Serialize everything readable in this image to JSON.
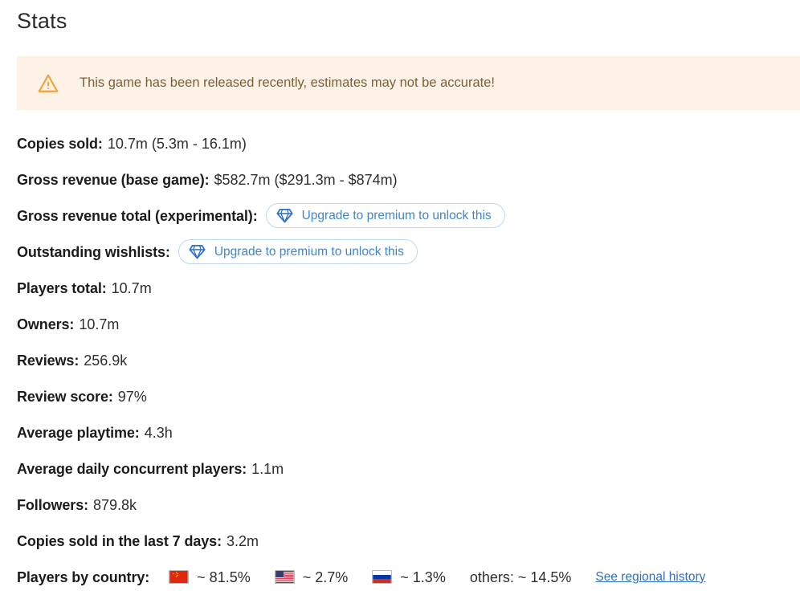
{
  "page_title": "Stats",
  "warning": {
    "icon": "warning-triangle-icon",
    "message": "This game has been released recently, estimates may not be accurate!",
    "background_color": "#fdf2e5",
    "text_color": "#7a6036",
    "icon_color": "#f0a33c"
  },
  "premium": {
    "icon": "gem-icon",
    "label": "Upgrade to premium to unlock this",
    "text_color": "#4285c9",
    "border_color": "#bcd7ef"
  },
  "stats": [
    {
      "label": "Copies sold:",
      "value": "10.7m (5.3m - 16.1m)",
      "locked": false
    },
    {
      "label": "Gross revenue (base game):",
      "value": "$582.7m ($291.3m - $874m)",
      "locked": false
    },
    {
      "label": "Gross revenue total (experimental):",
      "value": "",
      "locked": true
    },
    {
      "label": "Outstanding wishlists:",
      "value": "",
      "locked": true
    },
    {
      "label": "Players total:",
      "value": "10.7m",
      "locked": false
    },
    {
      "label": "Owners:",
      "value": "10.7m",
      "locked": false
    },
    {
      "label": "Reviews:",
      "value": "256.9k",
      "locked": false
    },
    {
      "label": "Review score:",
      "value": "97%",
      "locked": false
    },
    {
      "label": "Average playtime:",
      "value": "4.3h",
      "locked": false
    },
    {
      "label": "Average daily concurrent players:",
      "value": "1.1m",
      "locked": false
    },
    {
      "label": "Followers:",
      "value": "879.8k",
      "locked": false
    },
    {
      "label": "Copies sold in the last 7 days:",
      "value": "3.2m",
      "locked": false
    }
  ],
  "players_by_country": {
    "label": "Players by country:",
    "countries": [
      {
        "flag": "flag-china-icon",
        "country": "China",
        "percent": "~ 81.5%"
      },
      {
        "flag": "flag-united-states-icon",
        "country": "United States",
        "percent": "~ 2.7%"
      },
      {
        "flag": "flag-russia-icon",
        "country": "Russia",
        "percent": "~ 1.3%"
      }
    ],
    "others_label": "others: ~ 14.5%",
    "link_label": "See regional history",
    "link_color": "#2f6fc4"
  }
}
